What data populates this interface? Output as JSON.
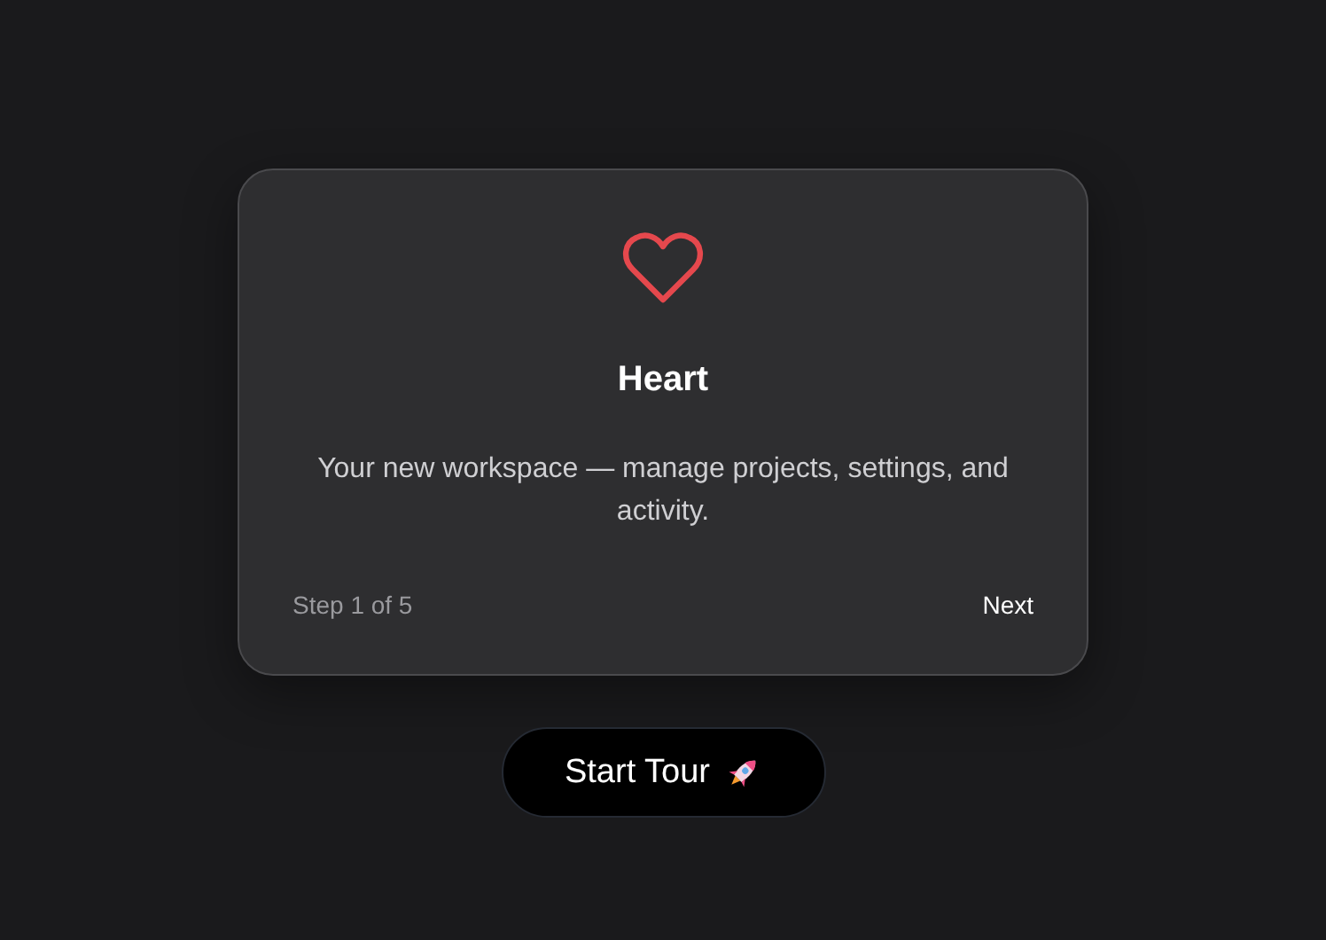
{
  "card": {
    "title": "Heart",
    "description": "Your new workspace — manage projects, settings, and activity.",
    "step": "Step 1 of 5",
    "next_label": "Next"
  },
  "start_button": {
    "label": "Start Tour"
  }
}
